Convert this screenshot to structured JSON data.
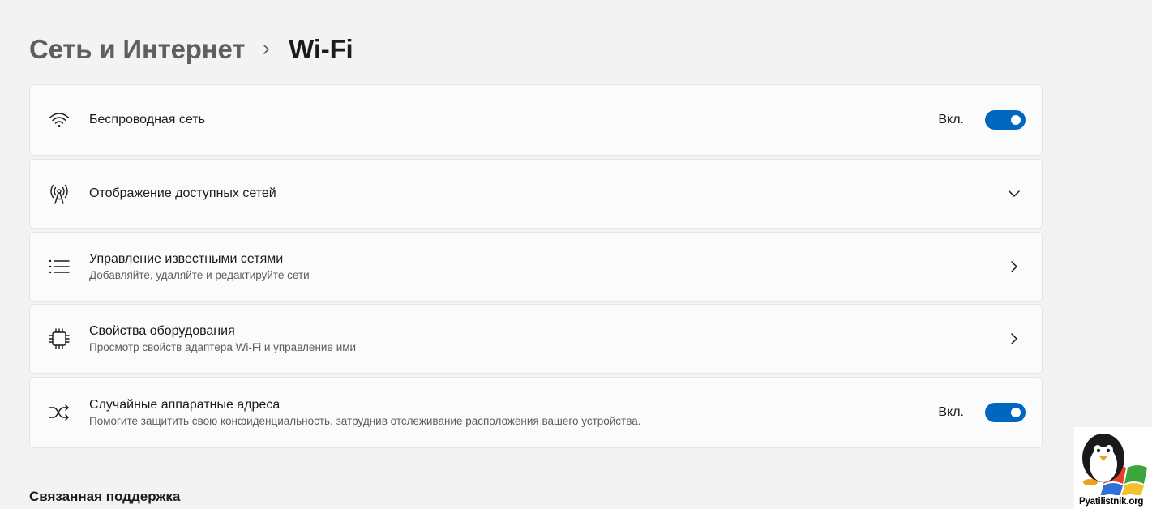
{
  "breadcrumb": {
    "parent": "Сеть и Интернет",
    "current": "Wi-Fi"
  },
  "cards": [
    {
      "title": "Беспроводная сеть",
      "state": "Вкл.",
      "toggle_on": true,
      "icon": "wifi-icon"
    },
    {
      "title": "Отображение доступных сетей",
      "icon": "antenna-icon",
      "action": "chevron-down-icon"
    },
    {
      "title": "Управление известными сетями",
      "subtitle": "Добавляйте, удаляйте и редактируйте сети",
      "icon": "list-icon",
      "action": "chevron-right-icon"
    },
    {
      "title": "Свойства оборудования",
      "subtitle": "Просмотр свойств адаптера Wi-Fi и управление ими",
      "icon": "chip-icon",
      "action": "chevron-right-icon"
    },
    {
      "title": "Случайные аппаратные адреса",
      "subtitle": "Помогите защитить свою конфиденциальность, затруднив отслеживание расположения вашего устройства.",
      "state": "Вкл.",
      "toggle_on": true,
      "icon": "shuffle-icon"
    }
  ],
  "related_support": {
    "heading": "Связанная поддержка"
  },
  "watermark": {
    "text": "Pyatilistnik.org"
  },
  "colors": {
    "accent": "#0067c0",
    "background": "#f3f3f3",
    "card": "#fbfbfb"
  }
}
